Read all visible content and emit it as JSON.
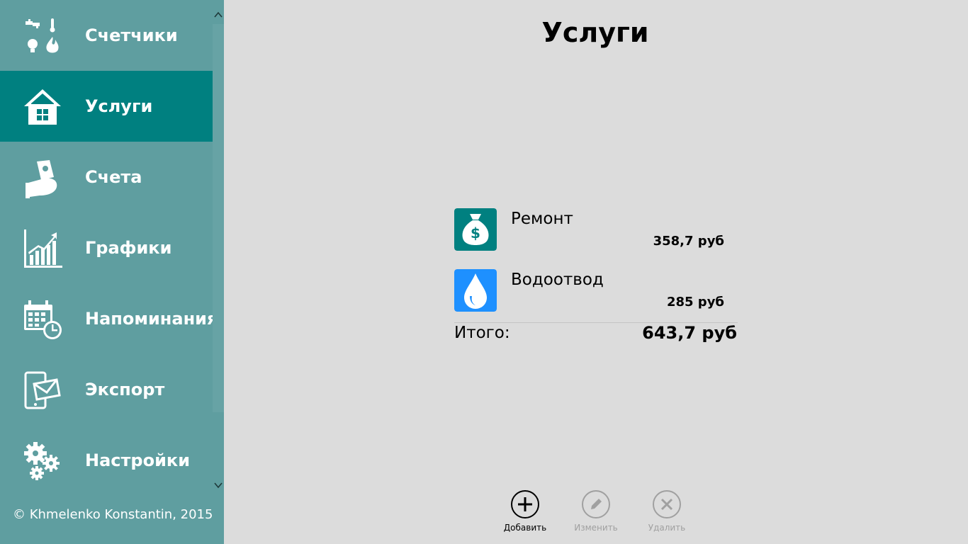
{
  "sidebar": {
    "items": [
      {
        "label": "Счетчики",
        "icon": "meters-icon"
      },
      {
        "label": "Услуги",
        "icon": "house-icon"
      },
      {
        "label": "Счета",
        "icon": "money-hand-icon"
      },
      {
        "label": "Графики",
        "icon": "chart-icon"
      },
      {
        "label": "Напоминания",
        "icon": "calendar-clock-icon"
      },
      {
        "label": "Экспорт",
        "icon": "phone-mail-icon"
      },
      {
        "label": "Настройки",
        "icon": "gears-icon"
      }
    ],
    "selected": "Услуги",
    "copyright": "© Khmelenko Konstantin, 2015"
  },
  "main": {
    "title": "Услуги",
    "services": [
      {
        "name": "Ремонт",
        "amount": "358,7 руб",
        "icon": "money-bag-icon",
        "color": "#008080"
      },
      {
        "name": "Водоотвод",
        "amount": "285 руб",
        "icon": "water-drop-icon",
        "color": "#1e90ff"
      }
    ],
    "total_label": "Итого:",
    "total_value": "643,7 руб"
  },
  "appbar": {
    "add_label": "Добавить",
    "edit_label": "Изменить",
    "delete_label": "Удалить"
  },
  "colors": {
    "sidebar": "#5f9ea0",
    "selected": "#008080",
    "background": "#dcdcdc"
  }
}
